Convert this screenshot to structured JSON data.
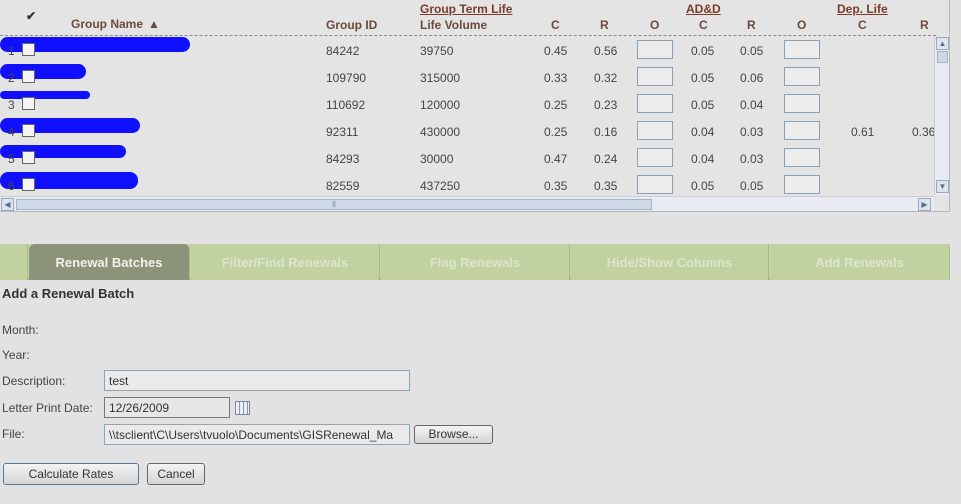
{
  "grid": {
    "columns": {
      "check": "✔",
      "group_name": "Group Name",
      "group_id": "Group ID",
      "group_term_life": "Group Term Life",
      "life_volume": "Life Volume",
      "add": "AD&D",
      "dep_life": "Dep. Life",
      "c": "C",
      "r": "R",
      "o": "O"
    },
    "rows": [
      {
        "num": "1",
        "group_id": "84242",
        "life_volume": "39750",
        "c": "0.45",
        "r": "0.56",
        "add_c": "0.05",
        "add_r": "0.05",
        "dep_c": "",
        "dep_r": ""
      },
      {
        "num": "2",
        "group_id": "109790",
        "life_volume": "315000",
        "c": "0.33",
        "r": "0.32",
        "add_c": "0.05",
        "add_r": "0.06",
        "dep_c": "",
        "dep_r": ""
      },
      {
        "num": "3",
        "group_id": "110692",
        "life_volume": "120000",
        "c": "0.25",
        "r": "0.23",
        "add_c": "0.05",
        "add_r": "0.04",
        "dep_c": "",
        "dep_r": ""
      },
      {
        "num": "4",
        "group_id": "92311",
        "life_volume": "430000",
        "c": "0.25",
        "r": "0.16",
        "add_c": "0.04",
        "add_r": "0.03",
        "dep_c": "0.61",
        "dep_r": "0.36"
      },
      {
        "num": "5",
        "group_id": "84293",
        "life_volume": "30000",
        "c": "0.47",
        "r": "0.24",
        "add_c": "0.04",
        "add_r": "0.03",
        "dep_c": "",
        "dep_r": ""
      },
      {
        "num": "6",
        "group_id": "82559",
        "life_volume": "437250",
        "c": "0.35",
        "r": "0.35",
        "add_c": "0.05",
        "add_r": "0.05",
        "dep_c": "",
        "dep_r": ""
      }
    ]
  },
  "tabs": [
    {
      "label": "Renewal Batches",
      "active": true
    },
    {
      "label": "Filter/Find Renewals",
      "active": false
    },
    {
      "label": "Flag Renewals",
      "active": false
    },
    {
      "label": "Hide/Show Columns",
      "active": false
    },
    {
      "label": "Add Renewals",
      "active": false
    }
  ],
  "form": {
    "title": "Add a Renewal Batch",
    "month_label": "Month:",
    "year_label": "Year:",
    "description_label": "Description:",
    "description_value": "test",
    "letter_date_label": "Letter Print Date:",
    "letter_date_value": "12/26/2009",
    "file_label": "File:",
    "file_value": "\\\\tsclient\\C\\Users\\tvuolo\\Documents\\GISRenewal_Ma",
    "browse_label": "Browse...",
    "calculate_label": "Calculate Rates",
    "cancel_label": "Cancel"
  },
  "colors": {
    "redaction": "#1010ff",
    "tab_active": "#8b9478",
    "tab_bar": "#c2d1a0"
  },
  "icons": [
    "checkmark-icon",
    "sort-ascending-icon",
    "calendar-icon",
    "scroll-up-icon",
    "scroll-down-icon",
    "scroll-left-icon",
    "scroll-right-icon"
  ]
}
